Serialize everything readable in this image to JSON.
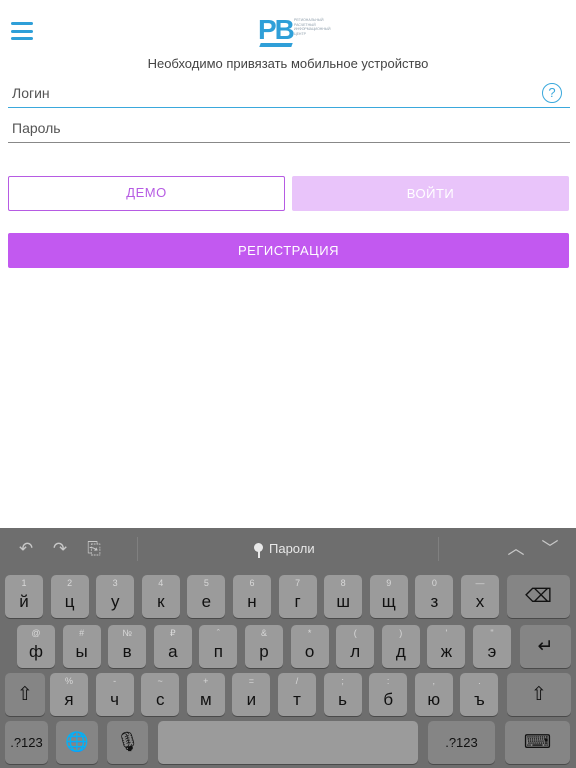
{
  "header": {
    "logo_mark": "PB",
    "logo_tagline": "Региональный расчетный информационный центр"
  },
  "subtitle": "Необходимо привязать мобильное устройство",
  "form": {
    "login_placeholder": "Логин",
    "password_placeholder": "Пароль",
    "help_glyph": "?"
  },
  "buttons": {
    "demo": "ДЕМО",
    "login": "ВОЙТИ",
    "register": "РЕГИСТРАЦИЯ"
  },
  "keyboard": {
    "toolbar": {
      "undo_glyph": "↶",
      "redo_glyph": "↷",
      "paste_glyph": "⎘",
      "passwords_label": "Пароли",
      "up_glyph": "︿",
      "down_glyph": "﹀"
    },
    "row1": [
      {
        "hint": "1",
        "char": "й"
      },
      {
        "hint": "2",
        "char": "ц"
      },
      {
        "hint": "3",
        "char": "у"
      },
      {
        "hint": "4",
        "char": "к"
      },
      {
        "hint": "5",
        "char": "е"
      },
      {
        "hint": "6",
        "char": "н"
      },
      {
        "hint": "7",
        "char": "г"
      },
      {
        "hint": "8",
        "char": "ш"
      },
      {
        "hint": "9",
        "char": "щ"
      },
      {
        "hint": "0",
        "char": "з"
      },
      {
        "hint": "—",
        "char": "х"
      }
    ],
    "row2": [
      {
        "hint": "@",
        "char": "ф"
      },
      {
        "hint": "#",
        "char": "ы"
      },
      {
        "hint": "№",
        "char": "в"
      },
      {
        "hint": "₽",
        "char": "а"
      },
      {
        "hint": "ˆ",
        "char": "п"
      },
      {
        "hint": "&",
        "char": "р"
      },
      {
        "hint": "*",
        "char": "о"
      },
      {
        "hint": "(",
        "char": "л"
      },
      {
        "hint": ")",
        "char": "д"
      },
      {
        "hint": "'",
        "char": "ж"
      },
      {
        "hint": "\"",
        "char": "э"
      }
    ],
    "row3": [
      {
        "hint": "%",
        "char": "я"
      },
      {
        "hint": "-",
        "char": "ч"
      },
      {
        "hint": "~",
        "char": "с"
      },
      {
        "hint": "+",
        "char": "м"
      },
      {
        "hint": "=",
        "char": "и"
      },
      {
        "hint": "/",
        "char": "т"
      },
      {
        "hint": ";",
        "char": "ь"
      },
      {
        "hint": ":",
        "char": "б"
      },
      {
        "hint": ",",
        "char": "ю"
      },
      {
        "hint": ".",
        "char": "ъ"
      }
    ],
    "special": {
      "backspace_glyph": "⌫",
      "return_glyph": "↵",
      "shift_glyph": "⇧",
      "numbers_label": ".?123",
      "globe_glyph": "🌐",
      "mic_glyph": "🎙",
      "hide_glyph": "⌨"
    }
  }
}
